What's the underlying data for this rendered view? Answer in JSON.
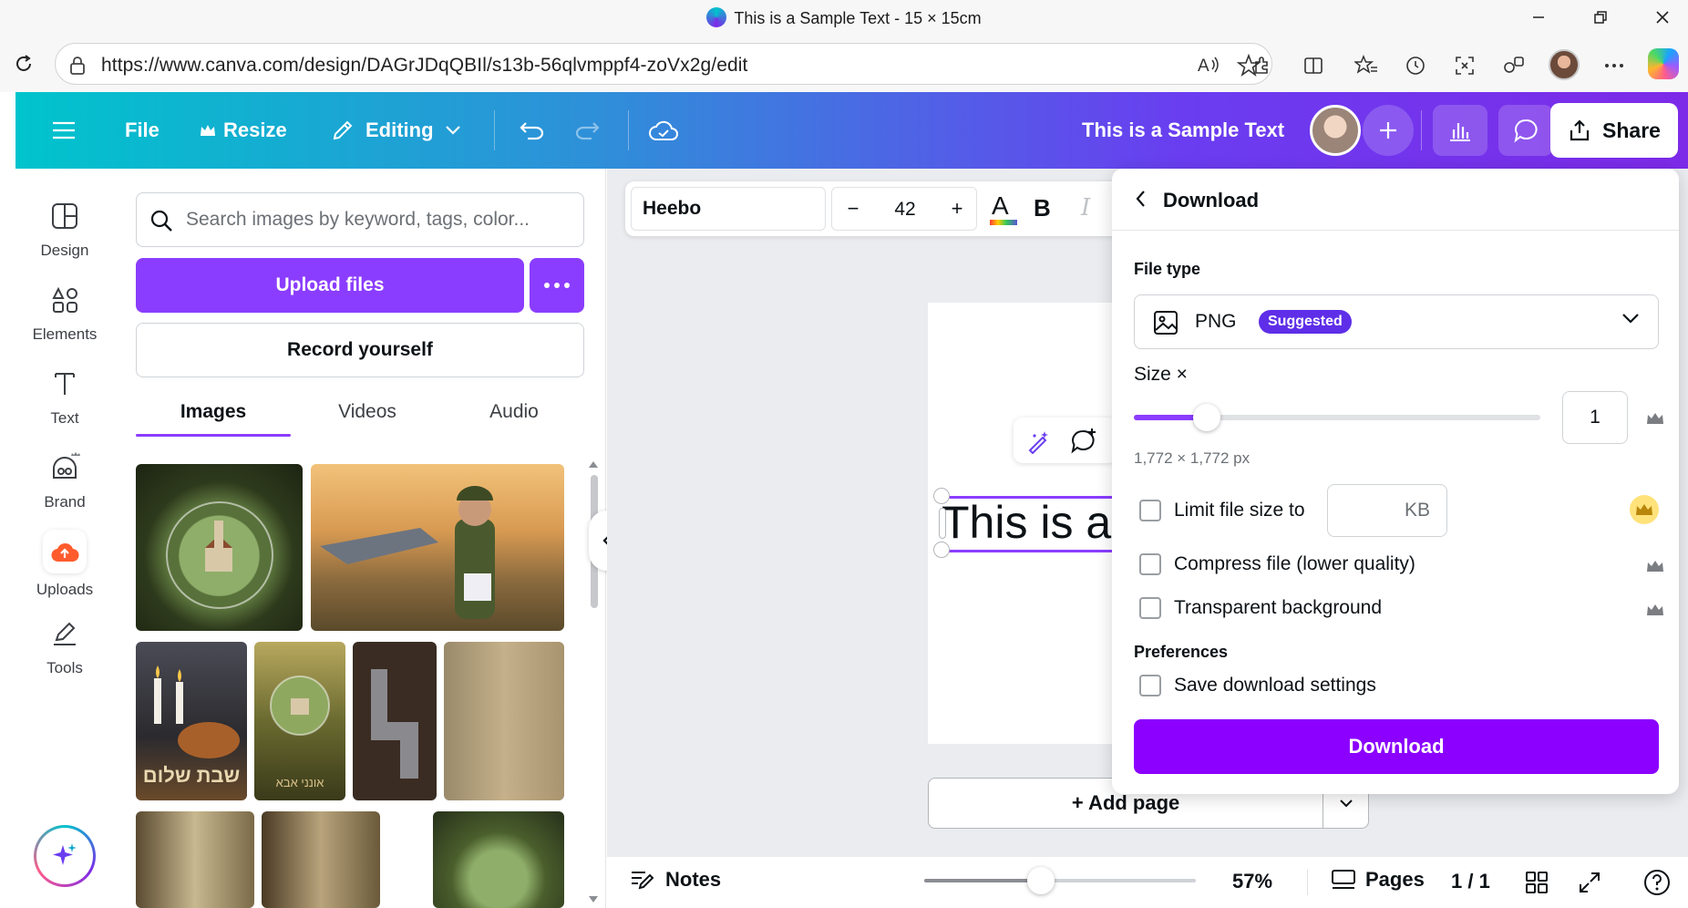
{
  "window": {
    "title": "This is a Sample Text - 15 × 15cm"
  },
  "browser": {
    "url": "https://www.canva.com/design/DAGrJDqQBIl/s13b-56qlvmppf4-zoVx2g/edit"
  },
  "header": {
    "file_label": "File",
    "resize_label": "Resize",
    "editing_label": "Editing",
    "design_title": "This is a Sample Text",
    "share_label": "Share",
    "gradient_start": "#00c4cc",
    "gradient_end": "#7d2ae8"
  },
  "rail": {
    "items": [
      {
        "label": "Design",
        "icon": "design-icon"
      },
      {
        "label": "Elements",
        "icon": "elements-icon"
      },
      {
        "label": "Text",
        "icon": "text-icon"
      },
      {
        "label": "Brand",
        "icon": "brand-icon"
      },
      {
        "label": "Uploads",
        "icon": "uploads-icon"
      },
      {
        "label": "Tools",
        "icon": "tools-icon"
      }
    ]
  },
  "panel": {
    "search_placeholder": "Search images by keyword, tags, color...",
    "upload_label": "Upload files",
    "record_label": "Record yourself",
    "tabs": [
      "Images",
      "Videos",
      "Audio"
    ],
    "active_tab": "Images",
    "hebrew_texts": [
      "שבת שלום",
      "אונני אבא"
    ]
  },
  "text_toolbar": {
    "font": "Heebo",
    "font_size": "42",
    "minus": "−",
    "plus": "+",
    "bold": "B",
    "italic": "I"
  },
  "canvas": {
    "selected_text": "This is a",
    "add_page_label": "+ Add page"
  },
  "bottombar": {
    "notes_label": "Notes",
    "zoom_value": "57%",
    "zoom_fraction": 0.43,
    "pages_label": "Pages",
    "page_count": "1 / 1"
  },
  "download": {
    "title": "Download",
    "file_type_label": "File type",
    "file_type_value": "PNG",
    "suggested_badge": "Suggested",
    "size_label": "Size ×",
    "size_value": "1",
    "size_fraction": 0.18,
    "dimensions": "1,772 × 1,772 px",
    "limit_label": "Limit file size to",
    "kb_unit": "KB",
    "compress_label": "Compress file (lower quality)",
    "transparent_label": "Transparent background",
    "preferences_label": "Preferences",
    "save_settings_label": "Save download settings",
    "download_button": "Download",
    "accent": "#8b3dff"
  }
}
